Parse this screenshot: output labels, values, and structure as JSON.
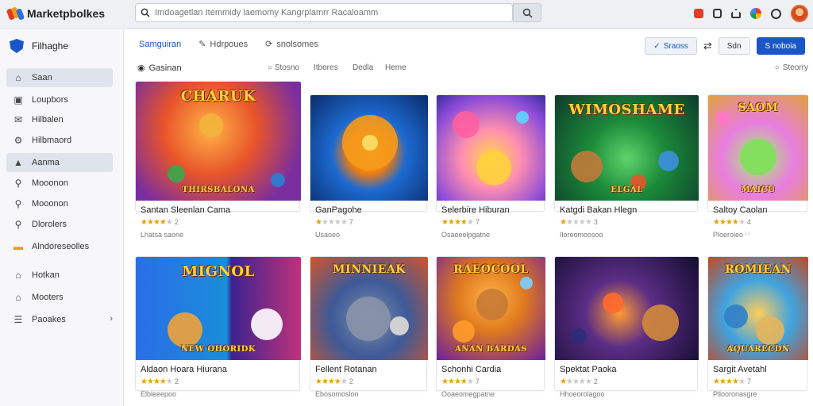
{
  "app": {
    "title": "Marketpbolkes"
  },
  "search": {
    "placeholder": "Imdoagetlan Itemmidy laemomy Kangrplamrr Racaloamm"
  },
  "sidebar": {
    "header": "Filhaghe",
    "items": [
      {
        "label": "Saan",
        "icon": "home-icon",
        "active": true
      },
      {
        "label": "Loupbors",
        "icon": "inbox-icon",
        "active": false
      },
      {
        "label": "Hilbalen",
        "icon": "gift-icon",
        "active": false
      },
      {
        "label": "Hilbmaord",
        "icon": "settings-icon",
        "active": false
      },
      {
        "label": "Aanma",
        "icon": "user-icon",
        "active": true
      },
      {
        "label": "Mooonon",
        "icon": "search-icon",
        "active": false
      },
      {
        "label": "Mooonon",
        "icon": "search-icon",
        "active": false
      },
      {
        "label": "Dlorolers",
        "icon": "search-icon",
        "active": false
      },
      {
        "label": "Alndoreseolles",
        "icon": "folder-icon",
        "active": false
      },
      {
        "label": "Hotkan",
        "icon": "home-icon",
        "active": false
      },
      {
        "label": "Mooters",
        "icon": "home-icon",
        "active": false
      },
      {
        "label": "Paoakes",
        "icon": "list-icon",
        "active": false
      }
    ]
  },
  "main": {
    "tabs": [
      {
        "label": "Samguiran",
        "active": true
      },
      {
        "label": "Hdrpoues",
        "active": false
      },
      {
        "label": "snolsomes",
        "active": false
      }
    ],
    "actions": {
      "a": "Sraoss",
      "b": "Sdn",
      "c": "S noboia"
    },
    "filters": {
      "category": "Gasinan",
      "options": [
        "Stosno",
        "Itbores",
        "Dedla",
        "Heme"
      ],
      "sort": "Steorry"
    }
  },
  "cards": [
    {
      "title": "Santan Sleenlan Cama",
      "art": "CHARUK",
      "art2": "THIRSBALONA",
      "rating": 4,
      "num": "2",
      "sub": "Lhatsa saone"
    },
    {
      "title": "GanPagohe",
      "art": "",
      "art2": "",
      "rating": 1,
      "num": "7",
      "sub": "Usaoeo"
    },
    {
      "title": "Selerbire Hiburan",
      "art": "",
      "art2": "",
      "rating": 4,
      "num": "7",
      "sub": "Osaoeolpgatne"
    },
    {
      "title": "Katgdi Bakan Hlegn",
      "art": "WIMOSHAME",
      "art2": "ELGAL",
      "rating": 1,
      "num": "3",
      "sub": "Iloreomoosoo"
    },
    {
      "title": "Saltoy Caolan",
      "art": "SAOM",
      "art2": "MAICU",
      "rating": 4,
      "num": "4",
      "sub": "Ploeroleo ⁱ ⁱ"
    },
    {
      "title": "Aldaon Hoara Hiurana",
      "art": "MIGNOL",
      "art2": "NEW OHORIDK",
      "rating": 4,
      "num": "2",
      "sub": "Elbleeepoo"
    },
    {
      "title": "Fellent Rotanan",
      "art": "MINNIEAK",
      "art2": "",
      "rating": 4,
      "num": "2",
      "sub": "Ebosomoslon"
    },
    {
      "title": "Schonhi Cardia",
      "art": "RAEOCOOL",
      "art2": "ANAN BARDAS",
      "rating": 4,
      "num": "7",
      "sub": "Ooaeomegpatne"
    },
    {
      "title": "Spektat Paoka",
      "art": "",
      "art2": "",
      "rating": 1,
      "num": "2",
      "sub": "Hhoeorolagoo"
    },
    {
      "title": "Sargit Avetahl",
      "art": "ROMIEAN",
      "art2": "AQUARECDN",
      "rating": 4,
      "num": "7",
      "sub": "Pllooronasgre"
    }
  ],
  "colors": {
    "accent": "#1a56c9",
    "star": "#e5a300"
  }
}
